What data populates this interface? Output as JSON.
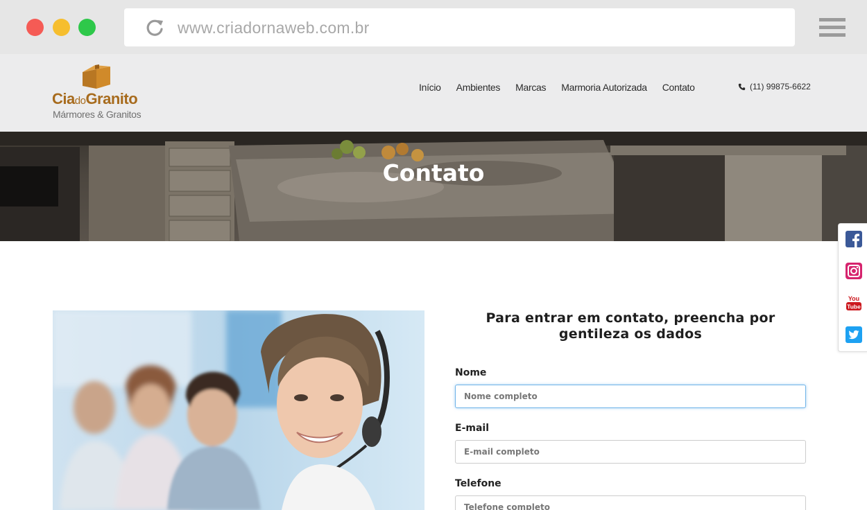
{
  "browser": {
    "url": "www.criadornaweb.com.br"
  },
  "logo": {
    "name_part1": "Cia",
    "name_part2": "do",
    "name_part3": "Granito",
    "subtitle": "Mármores & Granitos"
  },
  "nav": {
    "items": [
      {
        "label": "Início"
      },
      {
        "label": "Ambientes"
      },
      {
        "label": "Marcas"
      },
      {
        "label": "Marmoria Autorizada"
      },
      {
        "label": "Contato"
      }
    ]
  },
  "header": {
    "phone": "(11) 99875-6622"
  },
  "hero": {
    "title": "Contato"
  },
  "social": {
    "items": [
      "facebook-icon",
      "instagram-icon",
      "youtube-icon",
      "twitter-icon"
    ]
  },
  "form": {
    "title": "Para entrar em contato, preencha por gentileza os dados",
    "name_label": "Nome",
    "name_placeholder": "Nome completo",
    "email_label": "E-mail",
    "email_placeholder": "E-mail completo",
    "phone_label": "Telefone",
    "phone_placeholder": "Telefone completo"
  },
  "colors": {
    "brand": "#a76b1d",
    "focus": "#6fb3e8"
  }
}
